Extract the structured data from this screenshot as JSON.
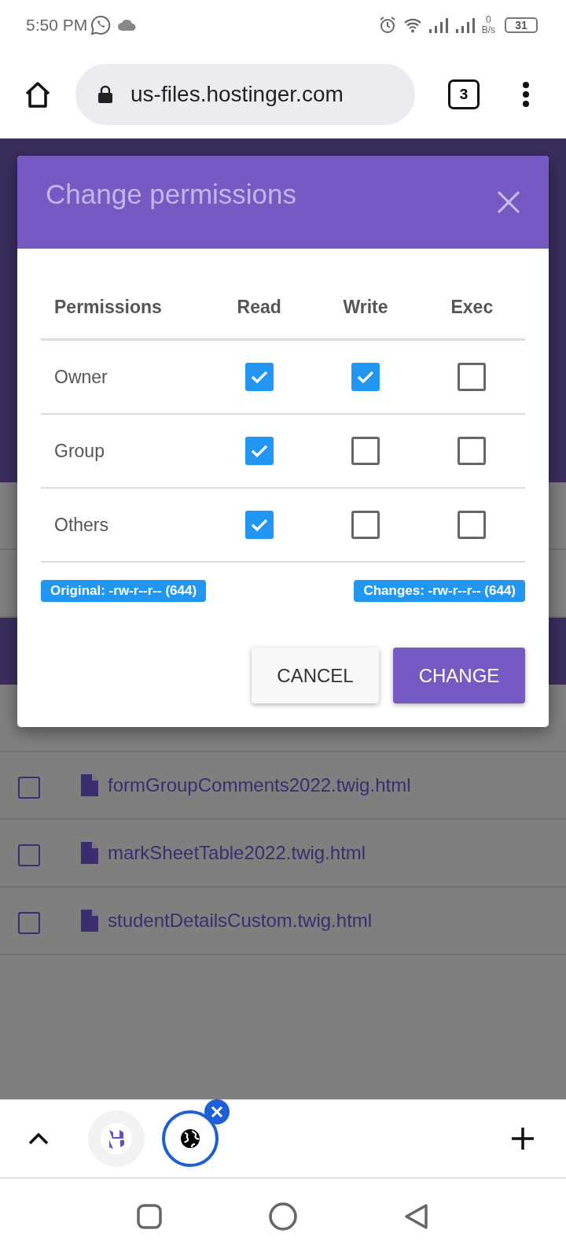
{
  "status_bar": {
    "time": "5:50 PM",
    "net_speed_value": "0",
    "net_speed_unit": "B/s",
    "battery": "31"
  },
  "browser": {
    "url": "us-files.hostinger.com",
    "tab_count": "3"
  },
  "files": [
    {
      "name": "formGroupComments2022.twig.html",
      "checked": false
    },
    {
      "name": "markSheetTable2022.twig.html",
      "checked": false
    },
    {
      "name": "studentDetailsCustom.twig.html",
      "checked": false
    }
  ],
  "dialog": {
    "title": "Change permissions",
    "columns": [
      "Permissions",
      "Read",
      "Write",
      "Exec"
    ],
    "rows": [
      {
        "label": "Owner",
        "checks": [
          {
            "checked": true
          },
          {
            "checked": true
          },
          {
            "checked": false
          }
        ]
      },
      {
        "label": "Group",
        "checks": [
          {
            "checked": true
          },
          {
            "checked": false
          },
          {
            "checked": false
          }
        ]
      },
      {
        "label": "Others",
        "checks": [
          {
            "checked": true
          },
          {
            "checked": false
          },
          {
            "checked": false
          }
        ]
      }
    ],
    "original": "Original: -rw-r--r-- (644)",
    "changes": "Changes: -rw-r--r-- (644)",
    "buttons": [
      {
        "label": "CANCEL",
        "kind": "secondary"
      },
      {
        "label": "CHANGE",
        "kind": "primary"
      }
    ]
  }
}
